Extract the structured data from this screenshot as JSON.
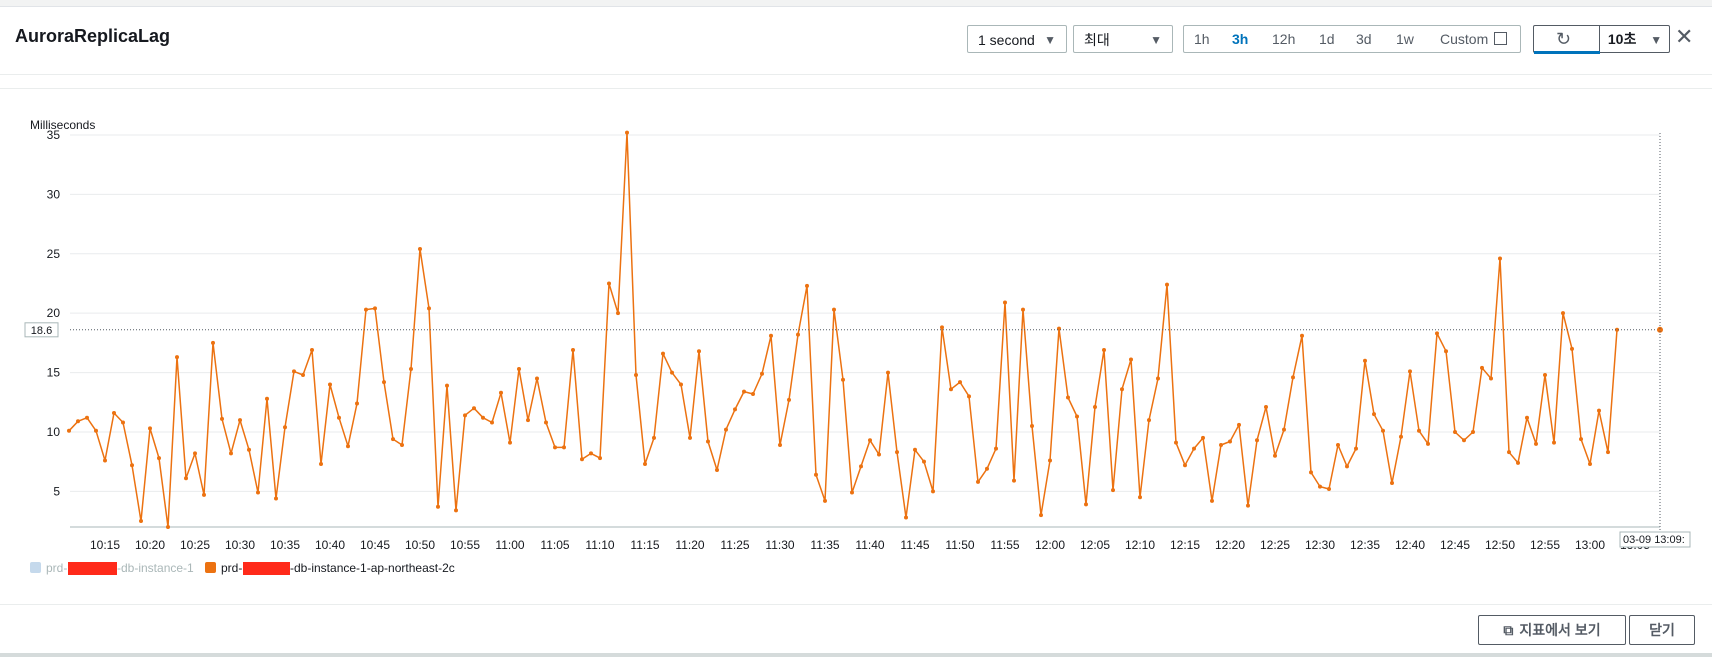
{
  "header": {
    "title": "AuroraReplicaLag",
    "period_select": "1 second",
    "stat_select": "최대",
    "time_ranges": [
      "1h",
      "3h",
      "12h",
      "1d",
      "3d",
      "1w"
    ],
    "active_range": "3h",
    "custom_label": "Custom",
    "refresh_interval": "10초"
  },
  "footer": {
    "view_metrics_label": "지표에서 보기",
    "close_label": "닫기"
  },
  "colors": {
    "series": "#ec7211",
    "series_dim": "#c5d9ec",
    "redaction": "#ff2a1a",
    "active": "#0073bb"
  },
  "chart_data": {
    "type": "line",
    "ylabel": "Milliseconds",
    "ylim": [
      2,
      35
    ],
    "yticks": [
      5,
      10,
      15,
      20,
      25,
      30,
      35
    ],
    "xlabels": [
      "10:15",
      "10:20",
      "10:25",
      "10:30",
      "10:35",
      "10:40",
      "10:45",
      "10:50",
      "10:55",
      "11:00",
      "11:05",
      "11:10",
      "11:15",
      "11:20",
      "11:25",
      "11:30",
      "11:35",
      "11:40",
      "11:45",
      "11:50",
      "11:55",
      "12:00",
      "12:05",
      "12:10",
      "12:15",
      "12:20",
      "12:25",
      "12:30",
      "12:35",
      "12:40",
      "12:45",
      "12:50",
      "12:55",
      "13:00",
      "13:05"
    ],
    "current_value_label": "18.6",
    "cursor_label": "03-09 13:09:",
    "legend": [
      {
        "prefix": "prd-",
        "suffix": "-db-instance-1",
        "dimmed": true
      },
      {
        "prefix": "prd-",
        "suffix": "-db-instance-1-ap-northeast-2c",
        "dimmed": false
      }
    ],
    "series": [
      {
        "name": "prd-[redacted]-db-instance-1-ap-northeast-2c",
        "start": "10:11",
        "interval_minutes": 1,
        "values": [
          10.1,
          10.9,
          11.2,
          10.1,
          7.6,
          11.6,
          10.8,
          7.2,
          2.5,
          10.3,
          7.8,
          1.9,
          16.3,
          6.1,
          8.2,
          4.7,
          17.5,
          11.1,
          8.2,
          11.0,
          8.5,
          4.9,
          12.8,
          4.4,
          10.4,
          15.1,
          14.8,
          16.9,
          7.3,
          14.0,
          11.2,
          8.8,
          12.4,
          20.3,
          20.4,
          14.2,
          9.4,
          8.9,
          15.3,
          25.4,
          20.4,
          3.7,
          13.9,
          3.4,
          11.4,
          12.0,
          11.2,
          10.8,
          13.3,
          9.1,
          15.3,
          11.0,
          14.5,
          10.8,
          8.7,
          8.7,
          16.9,
          7.7,
          8.2,
          7.8,
          22.5,
          20.0,
          35.2,
          14.8,
          7.3,
          9.5,
          16.6,
          15.0,
          14.0,
          9.5,
          16.8,
          9.2,
          6.8,
          10.2,
          11.9,
          13.4,
          13.2,
          14.9,
          18.1,
          8.9,
          12.7,
          18.2,
          22.3,
          6.4,
          4.2,
          20.3,
          14.4,
          4.9,
          7.1,
          9.3,
          8.1,
          15.0,
          8.3,
          2.8,
          8.5,
          7.5,
          5.0,
          18.8,
          13.6,
          14.2,
          13.0,
          5.8,
          6.9,
          8.6,
          20.9,
          5.9,
          20.3,
          10.5,
          3.0,
          7.6,
          18.7,
          12.9,
          11.3,
          3.9,
          12.1,
          16.9,
          5.1,
          13.6,
          16.1,
          4.5,
          11.0,
          14.5,
          22.4,
          9.1,
          7.2,
          8.6,
          9.5,
          4.2,
          8.9,
          9.2,
          10.6,
          3.8,
          9.3,
          12.1,
          8.0,
          10.2,
          14.6,
          18.1,
          6.6,
          5.4,
          5.2,
          8.9,
          7.1,
          8.6,
          16.0,
          11.5,
          10.1,
          5.7,
          9.6,
          15.1,
          10.1,
          9.0,
          18.3,
          16.8,
          10.0,
          9.3,
          10.0,
          15.4,
          14.5,
          24.6,
          8.3,
          7.4,
          11.2,
          9.0,
          14.8,
          9.1,
          20.0,
          17.0,
          9.4,
          7.3,
          11.8,
          8.3,
          18.6
        ]
      }
    ]
  }
}
